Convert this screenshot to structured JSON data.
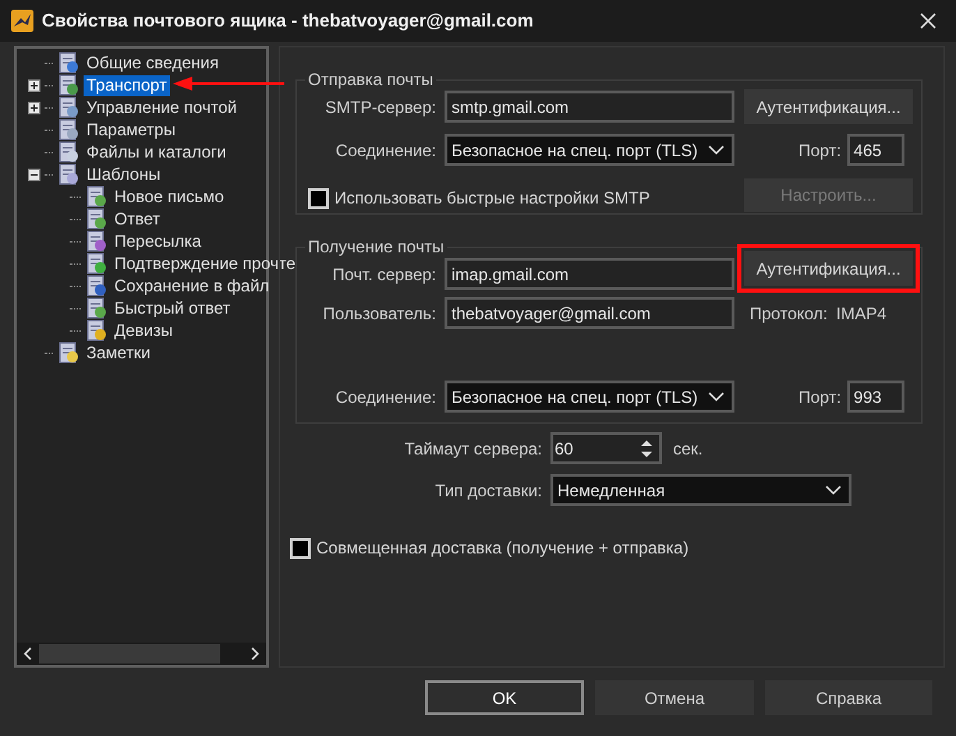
{
  "window": {
    "title": "Свойства почтового ящика - thebatvoyager@gmail.com"
  },
  "tree": {
    "items": [
      {
        "label": "Общие сведения",
        "selected": false
      },
      {
        "label": "Транспорт",
        "selected": true,
        "expanded": false
      },
      {
        "label": "Управление почтой",
        "selected": false,
        "expanded": false
      },
      {
        "label": "Параметры",
        "selected": false
      },
      {
        "label": "Файлы и каталоги",
        "selected": false
      },
      {
        "label": "Шаблоны",
        "selected": false,
        "expanded": true,
        "children": [
          {
            "label": "Новое письмо",
            "selected": false
          },
          {
            "label": "Ответ",
            "selected": false
          },
          {
            "label": "Пересылка",
            "selected": false
          },
          {
            "label": "Подтверждение прочте",
            "selected": false
          },
          {
            "label": "Сохранение в файл",
            "selected": false
          },
          {
            "label": "Быстрый ответ",
            "selected": false
          },
          {
            "label": "Девизы",
            "selected": false
          }
        ]
      },
      {
        "label": "Заметки",
        "selected": false
      }
    ]
  },
  "sending": {
    "title": "Отправка почты",
    "server": {
      "label": "SMTP-сервер:",
      "value": "smtp.gmail.com"
    },
    "auth_button": {
      "label": "Аутентификация..."
    },
    "connection": {
      "label": "Соединение:",
      "value": "Безопасное на спец. порт (TLS)"
    },
    "port": {
      "label": "Порт:",
      "value": "465"
    },
    "quick_smtp": {
      "label": "Использовать быстрые настройки SMTP",
      "checked": false
    },
    "configure_button": {
      "label": "Настроить...",
      "disabled": true
    }
  },
  "receiving": {
    "title": "Получение почты",
    "server": {
      "label": "Почт. сервер:",
      "value": "imap.gmail.com"
    },
    "auth_button": {
      "label": "Аутентификация..."
    },
    "user": {
      "label": "Пользователь:",
      "value": "thebatvoyager@gmail.com"
    },
    "protocol": {
      "label": "Протокол:",
      "value": "IMAP4"
    },
    "connection": {
      "label": "Соединение:",
      "value": "Безопасное на спец. порт (TLS)"
    },
    "port": {
      "label": "Порт:",
      "value": "993"
    }
  },
  "timeout": {
    "label": "Таймаут сервера:",
    "value": "60",
    "unit": "сек."
  },
  "delivery": {
    "label": "Тип доставки:",
    "value": "Немедленная"
  },
  "combined": {
    "label": "Совмещенная доставка (получение + отправка)",
    "checked": false
  },
  "buttons": [
    {
      "label": "OK",
      "default": true
    },
    {
      "label": "Отмена",
      "default": false
    },
    {
      "label": "Справка",
      "default": false
    }
  ]
}
